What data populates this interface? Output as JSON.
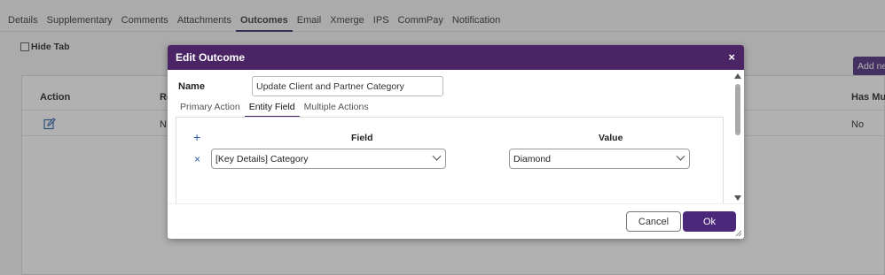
{
  "page_tabs": [
    {
      "label": "Details"
    },
    {
      "label": "Supplementary"
    },
    {
      "label": "Comments"
    },
    {
      "label": "Attachments"
    },
    {
      "label": "Outcomes",
      "active": true
    },
    {
      "label": "Email"
    },
    {
      "label": "Xmerge"
    },
    {
      "label": "IPS"
    },
    {
      "label": "CommPay"
    },
    {
      "label": "Notification"
    }
  ],
  "hide_tab_label": "Hide Tab",
  "add_new_label": "Add ne",
  "grid": {
    "headers": {
      "action": "Action",
      "col2": "Re",
      "col3": "Has Mult"
    },
    "row": {
      "col2": "N",
      "col3": "No"
    }
  },
  "modal": {
    "title": "Edit Outcome",
    "close_glyph": "×",
    "name_label": "Name",
    "name_value": "Update Client and Partner Category",
    "tabs": [
      {
        "label": "Primary Action"
      },
      {
        "label": "Entity Field",
        "active": true
      },
      {
        "label": "Multiple Actions"
      }
    ],
    "add_glyph": "+",
    "remove_glyph": "×",
    "field_header": "Field",
    "value_header": "Value",
    "field_selected": "[Key Details] Category",
    "value_selected": "Diamond",
    "cancel_label": "Cancel",
    "ok_label": "Ok"
  },
  "colors": {
    "header": "#4b2466",
    "primary_button": "#4b2879",
    "icon_blue": "#2b5fa8"
  }
}
